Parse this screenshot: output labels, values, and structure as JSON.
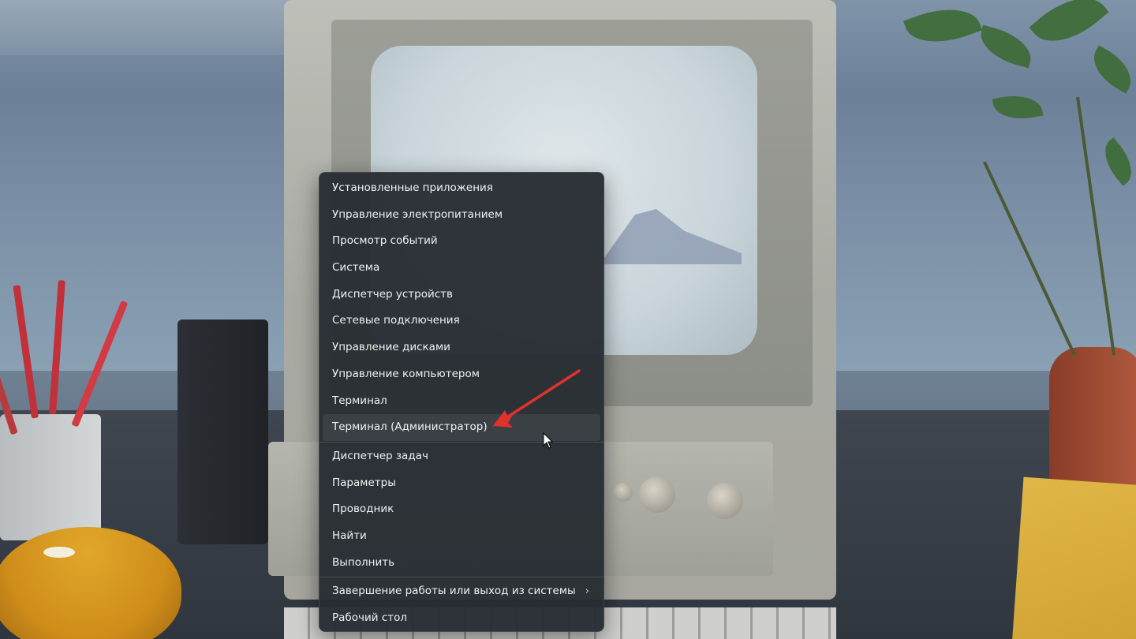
{
  "context_menu": {
    "items": [
      {
        "label": "Установленные приложения"
      },
      {
        "label": "Управление электропитанием"
      },
      {
        "label": "Просмотр событий"
      },
      {
        "label": "Система"
      },
      {
        "label": "Диспетчер устройств"
      },
      {
        "label": "Сетевые подключения"
      },
      {
        "label": "Управление дисками"
      },
      {
        "label": "Управление компьютером"
      },
      {
        "label": "Терминал"
      },
      {
        "label": "Терминал (Администратор)",
        "highlighted": true
      },
      {
        "label": "Диспетчер задач"
      },
      {
        "label": "Параметры"
      },
      {
        "label": "Проводник"
      },
      {
        "label": "Найти"
      },
      {
        "label": "Выполнить"
      },
      {
        "label": "Завершение работы или выход из системы",
        "has_submenu": true,
        "submenu_icon": "chevron-right-icon"
      },
      {
        "label": "Рабочий стол"
      }
    ]
  },
  "annotation": {
    "type": "red-arrow",
    "color": "#e0322d",
    "points_to": "Терминал (Администратор)"
  },
  "cursor": {
    "icon": "mouse-pointer-icon"
  },
  "colors": {
    "menu_background": "#282d33",
    "menu_text": "#f1f1f1",
    "hover_background": "#33383e"
  }
}
